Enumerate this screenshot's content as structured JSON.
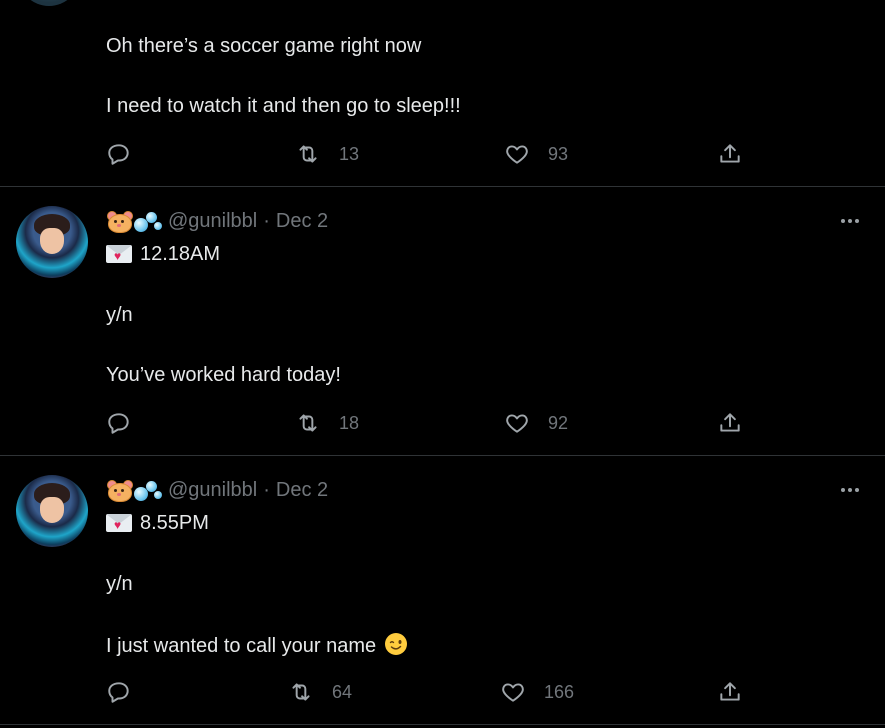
{
  "tweets": [
    {
      "lines": [
        "Oh there’s a soccer game right now",
        "I need to watch it and then go to sleep!!!"
      ],
      "replies": "",
      "retweets": "13",
      "likes": "93"
    },
    {
      "handle": "@gunilbbl",
      "separator": "·",
      "date": "Dec 2",
      "time": "12.18AM",
      "line1": "y/n",
      "line2": "You’ve worked hard today!",
      "retweets": "18",
      "likes": "92"
    },
    {
      "handle": "@gunilbbl",
      "separator": "·",
      "date": "Dec 2",
      "time": "8.55PM",
      "line1": "y/n",
      "line2": "I just wanted to call your name",
      "retweets": "64",
      "likes": "166"
    }
  ],
  "icons": {
    "reply": "reply-icon",
    "retweet": "retweet-icon",
    "like": "heart-icon",
    "share": "share-icon",
    "more": "more-options-icon",
    "envelope": "love-letter-emoji",
    "hamster": "hamster-emoji",
    "bubbles": "bubbles-emoji",
    "wink": "winking-face-emoji"
  },
  "colors": {
    "background": "#000000",
    "text": "#e7e9ea",
    "muted": "#71767b",
    "divider": "#2f3336"
  }
}
